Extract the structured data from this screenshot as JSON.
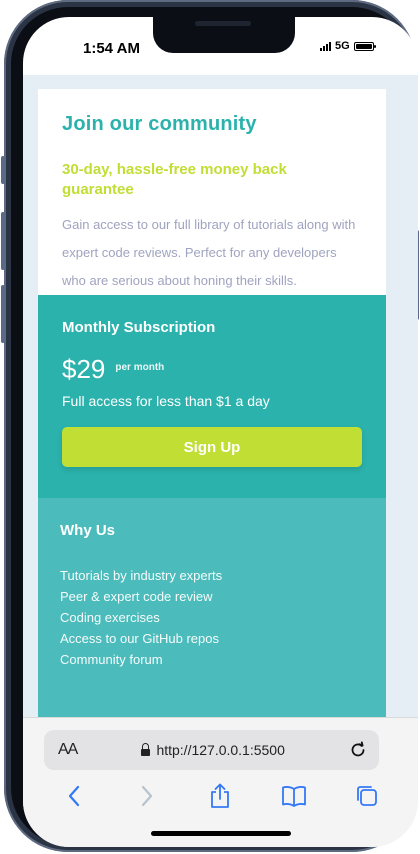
{
  "status_bar": {
    "time": "1:54 AM",
    "network": "5G"
  },
  "community": {
    "title": "Join our community",
    "guarantee": "30-day, hassle-free money back guarantee",
    "description": "Gain access to our full library of tutorials along with expert code reviews. Perfect for any developers who are serious about honing their skills."
  },
  "subscription": {
    "title": "Monthly Subscription",
    "price": "$29",
    "per_month": "per month",
    "description": "Full access for less than $1 a day",
    "signup_label": "Sign Up"
  },
  "why_us": {
    "title": "Why Us",
    "items": [
      "Tutorials by industry experts",
      "Peer & expert code review",
      "Coding exercises",
      "Access to our GitHub repos",
      "Community forum"
    ]
  },
  "browser": {
    "text_size_label": "AA",
    "url": "http://127.0.0.1:5500"
  },
  "colors": {
    "teal": "#2bb2ac",
    "light_teal": "#4bbcbb",
    "lime": "#c1de34",
    "gray_text": "#a0a3c0",
    "page_bg": "#e5edf5",
    "safari_blue": "#3478f6"
  },
  "icons": {
    "signal": "cellular-signal-icon",
    "battery": "battery-icon",
    "lock": "lock-icon",
    "reload": "reload-icon",
    "back": "chevron-left-icon",
    "forward": "chevron-right-icon",
    "share": "share-icon",
    "bookmarks": "book-icon",
    "tabs": "tabs-icon"
  }
}
